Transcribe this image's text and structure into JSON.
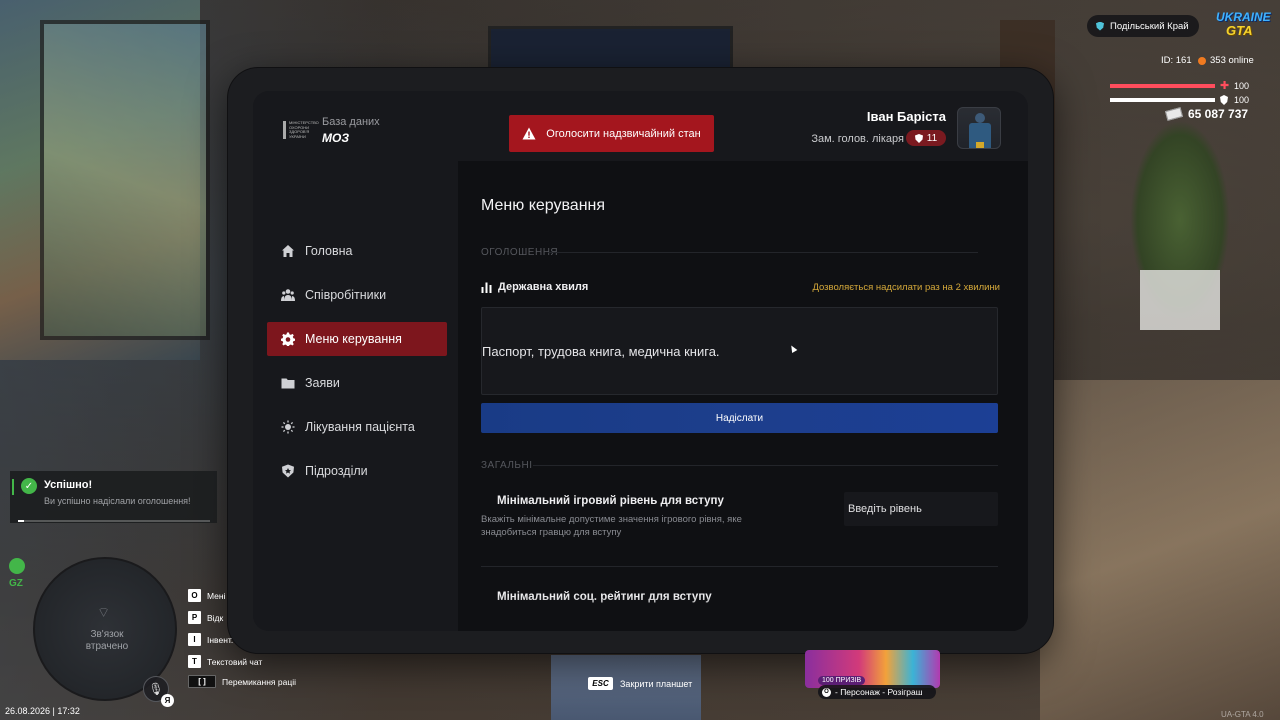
{
  "hud": {
    "server_name": "Подільський Край",
    "game_logo_line1": "UKRAINE",
    "game_logo_line2": "GTA",
    "player_id": "ID: 161",
    "online": "353 online",
    "health_value": "100",
    "armor_value": "100",
    "health_level": 1.0,
    "armor_level": 1.0,
    "money": "65 087 737",
    "health_color": "#ff4d5d",
    "armor_color": "#ffffff"
  },
  "tablet": {
    "logo_text": "МІНІСТЕРСТВО ОХОРОНИ ЗДОРОВ'Я УКРАЇНИ",
    "db_label": "База даних",
    "db_name": "МОЗ",
    "alert_button": "Оголосити надзвичайний стан",
    "user": {
      "name": "Іван Баріста",
      "role": "Зам. голов. лікаря",
      "rank": "11"
    },
    "sidebar": {
      "items": [
        {
          "label": "Головна",
          "icon": "home-icon",
          "active": false
        },
        {
          "label": "Співробітники",
          "icon": "people-icon",
          "active": false
        },
        {
          "label": "Меню керування",
          "icon": "gear-icon",
          "active": true
        },
        {
          "label": "Заяви",
          "icon": "folder-icon",
          "active": false
        },
        {
          "label": "Лікування пацієнта",
          "icon": "sun-icon",
          "active": false
        },
        {
          "label": "Підрозділи",
          "icon": "shield-icon",
          "active": false
        }
      ]
    },
    "main": {
      "title": "Меню керування",
      "announcements_header": "ОГОЛОШЕННЯ",
      "wave_title": "Державна хвиля",
      "wave_note": "Дозволяється надсилати раз на 2 хвилини",
      "message_value": "Паспорт, трудова книга, медична книга.",
      "send_button": "Надіслати",
      "general_header": "ЗАГАЛЬНІ",
      "min_level_title": "Мінімальний ігровий рівень для вступу",
      "min_level_desc": "Вкажіть мінімальне допустиме значення ігрового рівня, яке знадобиться гравцю для вступу",
      "min_level_placeholder": "Введіть рівень",
      "next_setting_title": "Мінімальний соц. рейтинг для вступу"
    }
  },
  "notification": {
    "title": "Успішно!",
    "text": "Ви успішно надіслали оголошення!"
  },
  "minimap": {
    "zone_label": "GZ",
    "status": "Зв'язок\nвтрачено"
  },
  "voice_badge": "Я",
  "datetime": "26.08.2026 | 17:32",
  "keybinds": [
    {
      "key": "O",
      "label": "Мені"
    },
    {
      "key": "P",
      "label": "Відк"
    },
    {
      "key": "I",
      "label": "Інвент."
    },
    {
      "key": "T",
      "label": "Текстовий чат"
    },
    {
      "key": "[ ]",
      "label": "Перемикання раціі"
    }
  ],
  "esc_hint": {
    "key": "ESC",
    "label": "Закрити планшет"
  },
  "promo": {
    "badge": "100 ПРИЗІВ",
    "key": "O",
    "label": "- Персонаж - Розіграш"
  },
  "version": "UA-GTA 4.0"
}
